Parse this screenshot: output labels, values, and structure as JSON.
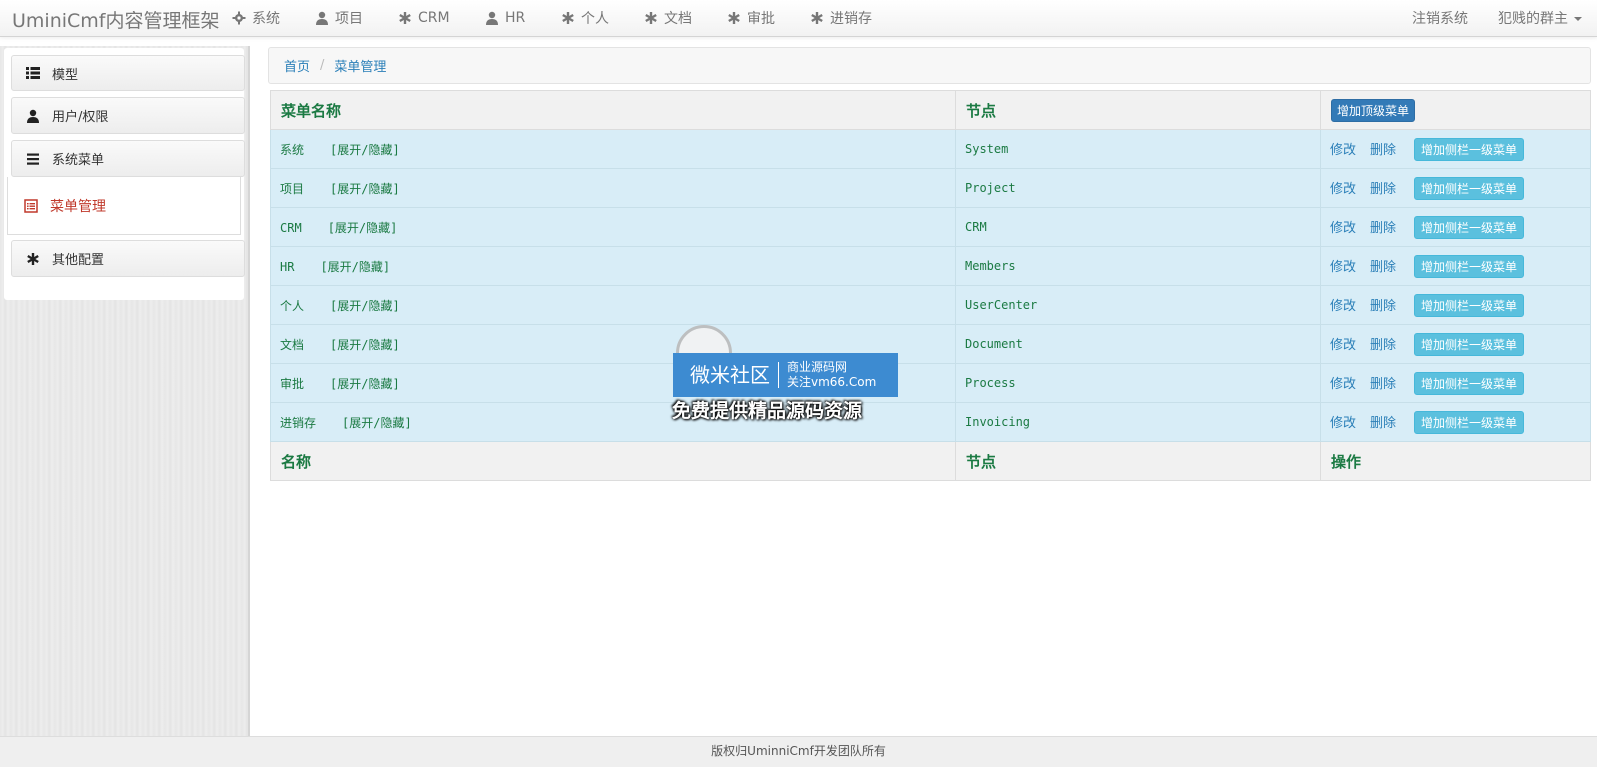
{
  "navbar": {
    "brand": "UminiCmf内容管理框架",
    "items": [
      {
        "label": "系统",
        "icon": "gear-icon"
      },
      {
        "label": "项目",
        "icon": "user-icon"
      },
      {
        "label": "CRM",
        "icon": "asterisk-icon"
      },
      {
        "label": "HR",
        "icon": "user-icon"
      },
      {
        "label": "个人",
        "icon": "asterisk-icon"
      },
      {
        "label": "文档",
        "icon": "asterisk-icon"
      },
      {
        "label": "审批",
        "icon": "asterisk-icon"
      },
      {
        "label": "进销存",
        "icon": "asterisk-icon"
      }
    ],
    "logout": "注销系统",
    "user": "犯贱的群主"
  },
  "sidebar": {
    "items": [
      {
        "label": "模型",
        "icon": "list-icon"
      },
      {
        "label": "用户/权限",
        "icon": "user-icon"
      },
      {
        "label": "系统菜单",
        "icon": "menu-icon"
      },
      {
        "label": "其他配置",
        "icon": "asterisk-icon"
      }
    ],
    "active_sub": {
      "label": "菜单管理",
      "icon": "list-alt-icon"
    }
  },
  "breadcrumb": {
    "home": "首页",
    "current": "菜单管理"
  },
  "table": {
    "headers": {
      "name": "菜单名称",
      "node": "节点",
      "add_top_button": "增加顶级菜单"
    },
    "rows": [
      {
        "name": "系统",
        "toggle": "[展开/隐藏]",
        "node": "System"
      },
      {
        "name": "项目",
        "toggle": "[展开/隐藏]",
        "node": "Project"
      },
      {
        "name": "CRM",
        "toggle": "[展开/隐藏]",
        "node": "CRM"
      },
      {
        "name": "HR",
        "toggle": "[展开/隐藏]",
        "node": "Members"
      },
      {
        "name": "个人",
        "toggle": "[展开/隐藏]",
        "node": "UserCenter"
      },
      {
        "name": "文档",
        "toggle": "[展开/隐藏]",
        "node": "Document"
      },
      {
        "name": "审批",
        "toggle": "[展开/隐藏]",
        "node": "Process"
      },
      {
        "name": "进销存",
        "toggle": "[展开/隐藏]",
        "node": "Invoicing"
      }
    ],
    "row_actions": {
      "edit": "修改",
      "delete": "删除",
      "add_sub": "增加侧栏一级菜单"
    },
    "footer_headers": {
      "name": "名称",
      "node": "节点",
      "action": "操作"
    }
  },
  "watermark": {
    "title": "微米社区",
    "line1": "商业源码网",
    "line2": "关注vm66.Com",
    "caption": "免费提供精品源码资源"
  },
  "footer": {
    "text": "版权归UminniCmf开发团队所有"
  },
  "colors": {
    "link": "#2a7fb8",
    "green_text": "#1b7a43",
    "row_bg": "#d8edf7",
    "active_menu": "#c0392b",
    "info_button": "#5bc0de",
    "primary_button": "#337ab7"
  }
}
